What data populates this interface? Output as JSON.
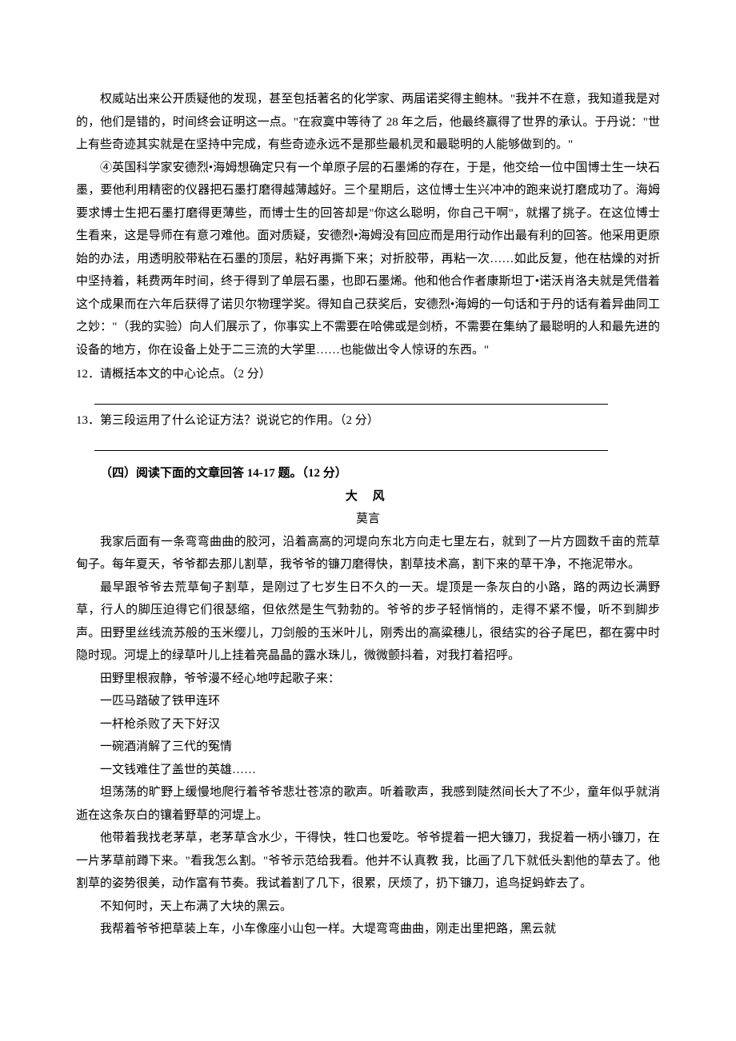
{
  "passage1": {
    "p_continued": "权威站出来公开质疑他的发现，甚至包括著名的化学家、两届诺奖得主鲍林。\"我并不在意，我知道我是对的，他们是错的，时间终会证明这一点。\"在寂寞中等待了 28 年之后，他最终赢得了世界的承认。于丹说：\"世上有些奇迹其实就是在坚持中完成，有些奇迹永远不是那些最机灵和最聪明的人能够做到的。\"",
    "p4": "④英国科学家安德烈•海姆想确定只有一个单原子层的石墨烯的存在，于是，他交给一位中国博士生一块石墨，要他利用精密的仪器把石墨打磨得越薄越好。三个星期后，这位博士生兴冲冲的跑来说打磨成功了。海姆要求博士生把石墨打磨得更薄些，而博士生的回答却是\"你这么聪明，你自己干啊\"，就撂了挑子。在这位博士生看来，这是导师在有意刁难他。面对质疑，安德烈•海姆没有回应而是用行动作出最有利的回答。他采用更原始的办法，用透明胶带粘在石墨的顶层，粘好再撕下来；对折胶带，再粘一次……如此反复，他在枯燥的对折中坚持着，耗费两年时间，终于得到了单层石墨，也即石墨烯。他和他合作者康斯坦丁•诺沃肖洛夫就是凭借着这个成果而在六年后获得了诺贝尔物理学奖。得知自己获奖后，安德烈•海姆的一句话和于丹的话有着异曲同工之妙：\"（我的实验）向人们展示了，你事实上不需要在哈佛或是剑桥，不需要在集纳了最聪明的人和最先进的设备的地方，你在设备上处于二三流的大学里……也能做出令人惊讶的东西。\""
  },
  "questions": {
    "q12": "12．请概括本文的中心论点。（2 分）",
    "q13": "13．第三段运用了什么论证方法？说说它的作用。（2 分）"
  },
  "section4": {
    "header": "（四）阅读下面的文章回答 14-17 题。（12 分）",
    "title": "大  风",
    "author": "莫言",
    "p1": "我家后面有一条弯弯曲曲的胶河，沿着高高的河堤向东北方向走七里左右，就到了一片方圆数千亩的荒草甸子。每年夏天，爷爷都去那儿割草，我爷爷的镰刀磨得快，割草技术高，割下来的草干净，不拖泥带水。",
    "p2": "最早跟爷爷去荒草甸子割草，是刚过了七岁生日不久的一天。堤顶是一条灰白的小路，路的两边长满野草，行人的脚压迫得它们很瑟缩，但依然是生气勃勃的。爷爷的步子轻悄悄的，走得不紧不慢，听不到脚步声。田野里丝线流苏般的玉米缨儿，刀剑般的玉米叶儿，刚秀出的高粱穗儿，很结实的谷子尾巴，都在雾中时隐时现。河堤上的绿草叶儿上挂着亮晶晶的露水珠儿，微微颤抖着，对我打着招呼。",
    "p3": "田野里根寂静，爷爷漫不经心地哼起歌子来：",
    "song1": "一匹马踏破了铁甲连环",
    "song2": "一杆枪杀败了天下好汉",
    "song3": "一碗酒消解了三代的冤情",
    "song4": "一文钱难住了盖世的英雄……",
    "p4": "坦荡荡的旷野上缓慢地爬行着爷爷悲壮苍凉的歌声。听着歌声，我感到陡然间长大了不少，童年似乎就消逝在这条灰白的镶着野草的河堤上。",
    "p5": "他带着我找老茅草，老茅草含水少，干得快，牲口也爱吃。爷爷提着一把大镰刀，我捉着一柄小镰刀，在一片茅草前蹲下来。\"看我怎么割。\"爷爷示范给我看。他并不认真教 我，比画了几下就低头割他的草去了。他割草的姿势很美，动作富有节奏。我试着割了几下，很累，厌烦了，扔下镰刀，追鸟捉蚂蚱去了。",
    "p6": "不知何时，天上布满了大块的黑云。",
    "p7": "我帮着爷爷把草装上车，小车像座小山包一样。大堤弯弯曲曲，刚走出里把路，黑云就"
  }
}
